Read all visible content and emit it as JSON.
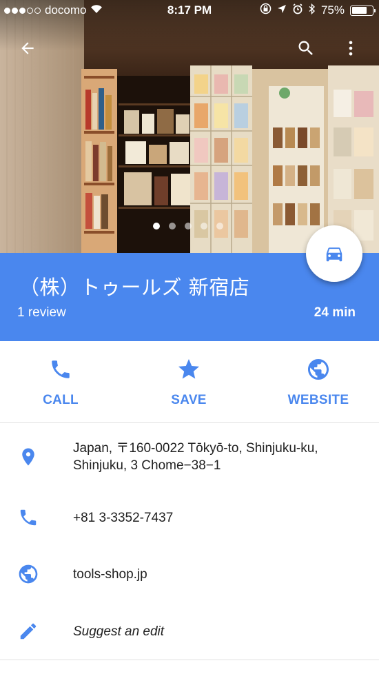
{
  "status_bar": {
    "carrier": "docomo",
    "time": "8:17 PM",
    "battery_percent": "75%",
    "battery_level": 0.75,
    "signal_bars_filled": 3,
    "signal_bars_total": 5
  },
  "photo_carousel": {
    "total_photos": 5,
    "active_index": 0
  },
  "place": {
    "name": "（株）トゥールズ 新宿店",
    "reviews": "1 review",
    "travel_time": "24 min"
  },
  "actions": {
    "call_label": "CALL",
    "save_label": "SAVE",
    "website_label": "WEBSITE"
  },
  "details": {
    "address_line1": "Japan, 〒160-0022 Tōkyō-to, Shinjuku-ku,",
    "address_line2": "Shinjuku, 3 Chome−38−1",
    "phone": "+81 3-3352-7437",
    "website": "tools-shop.jp",
    "suggest_edit": "Suggest an edit"
  },
  "icons": {
    "back": "arrow-back-icon",
    "search": "search-icon",
    "more": "more-vert-icon",
    "directions": "car-icon",
    "call": "phone-icon",
    "save": "star-icon",
    "website": "globe-icon",
    "address": "location-pin-icon",
    "edit": "pencil-icon"
  },
  "colors": {
    "accent": "#4a87ee",
    "text": "#212121",
    "divider": "#e0e0e0"
  }
}
